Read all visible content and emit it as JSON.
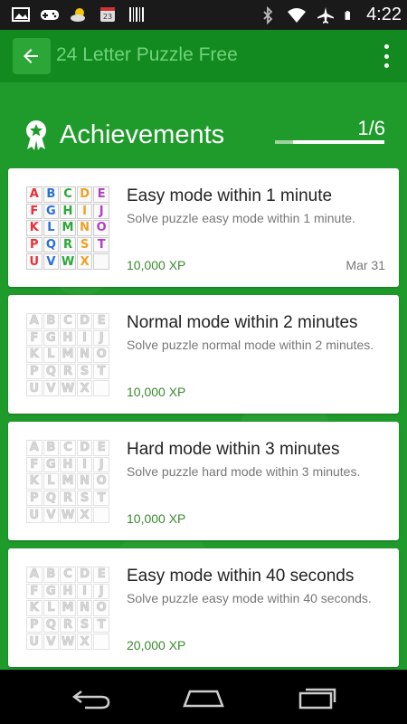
{
  "status_bar": {
    "time": "4:22",
    "left_icons": [
      "image-icon",
      "gamepad-icon",
      "weather-icon",
      "calendar-icon",
      "barcode-icon"
    ],
    "right_icons": [
      "bluetooth-icon",
      "wifi-icon",
      "airplane-icon",
      "battery-icon"
    ]
  },
  "app_bar": {
    "title": "24 Letter Puzzle Free",
    "back_icon": "arrow-back-icon",
    "menu_icon": "overflow-menu-icon"
  },
  "achievements": {
    "title": "Achievements",
    "progress_text": "1/6",
    "progress_fraction": 0.167,
    "items": [
      {
        "title": "Easy mode within 1 minute",
        "description": "Solve puzzle easy mode within 1 minute.",
        "xp": "10,000 XP",
        "date": "Mar 31",
        "unlocked": true
      },
      {
        "title": "Normal mode within 2 minutes",
        "description": "Solve puzzle normal mode within 2 minutes.",
        "xp": "10,000 XP",
        "date": "",
        "unlocked": false
      },
      {
        "title": "Hard mode within 3 minutes",
        "description": "Solve puzzle hard mode within 3 minutes.",
        "xp": "10,000 XP",
        "date": "",
        "unlocked": false
      },
      {
        "title": "Easy mode within 40 seconds",
        "description": "Solve puzzle easy mode within 40 seconds.",
        "xp": "20,000 XP",
        "date": "",
        "unlocked": false
      }
    ]
  },
  "tile_letters": [
    "A",
    "B",
    "C",
    "D",
    "E",
    "F",
    "G",
    "H",
    "I",
    "J",
    "K",
    "L",
    "M",
    "N",
    "O",
    "P",
    "Q",
    "R",
    "S",
    "T",
    "U",
    "V",
    "W",
    "X",
    ""
  ],
  "tile_colors": [
    "#e8303a",
    "#2a6fd6",
    "#2aa83a",
    "#f0a020",
    "#b040c0",
    "#e8303a",
    "#2a6fd6",
    "#2aa83a",
    "#f0a020",
    "#b040c0",
    "#e8303a",
    "#2a6fd6",
    "#2aa83a",
    "#f0a020",
    "#b040c0",
    "#e8303a",
    "#2a6fd6",
    "#2aa83a",
    "#f0a020",
    "#b040c0",
    "#e8303a",
    "#2a6fd6",
    "#2aa83a",
    "#f0a020",
    "#b040c0"
  ],
  "nav_bar": {
    "icons": [
      "nav-back-icon",
      "nav-home-icon",
      "nav-recents-icon"
    ]
  }
}
